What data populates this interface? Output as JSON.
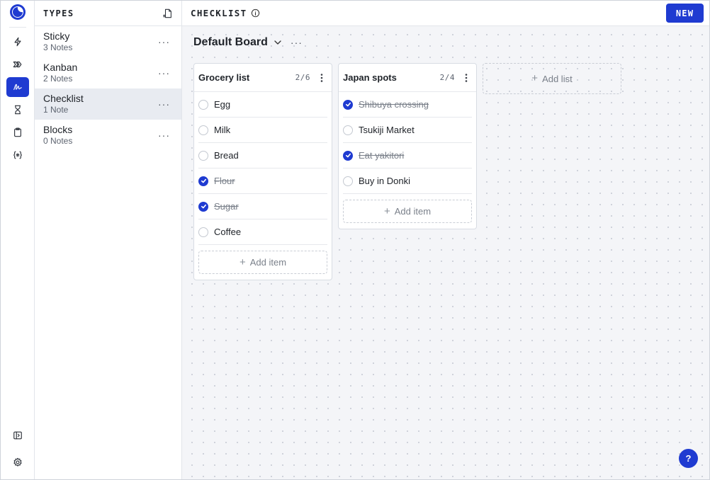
{
  "types_panel": {
    "title": "TYPES",
    "items": [
      {
        "name": "Sticky",
        "count": "3 Notes"
      },
      {
        "name": "Kanban",
        "count": "2 Notes"
      },
      {
        "name": "Checklist",
        "count": "1 Note"
      },
      {
        "name": "Blocks",
        "count": "0 Notes"
      }
    ],
    "more_label": "···"
  },
  "header": {
    "title": "CHECKLIST",
    "new_label": "NEW"
  },
  "board": {
    "name": "Default Board",
    "more_label": "···",
    "lists": [
      {
        "title": "Grocery list",
        "count": "2/6",
        "items": [
          {
            "text": "Egg",
            "done": false
          },
          {
            "text": "Milk",
            "done": false
          },
          {
            "text": "Bread",
            "done": false
          },
          {
            "text": "Flour",
            "done": true
          },
          {
            "text": "Sugar",
            "done": true
          },
          {
            "text": "Coffee",
            "done": false
          }
        ],
        "add_item_label": "Add item"
      },
      {
        "title": "Japan spots",
        "count": "2/4",
        "items": [
          {
            "text": "Shibuya crossing",
            "done": true
          },
          {
            "text": "Tsukiji Market",
            "done": false
          },
          {
            "text": "Eat yakitori",
            "done": true
          },
          {
            "text": "Buy in Donki",
            "done": false
          }
        ],
        "add_item_label": "Add item"
      }
    ],
    "add_list_label": "Add list"
  },
  "help_label": "?",
  "colors": {
    "accent": "#1f3bd1",
    "panel_active": "#e8ebf1",
    "canvas_bg": "#f4f5f8"
  },
  "icons": {
    "rail": [
      "bolt-icon",
      "chevrons-right-icon",
      "scribble-icon",
      "hourglass-icon",
      "clipboard-icon",
      "braces-icon"
    ],
    "rail_bottom": [
      "sidebar-toggle-icon",
      "gear-icon"
    ]
  }
}
